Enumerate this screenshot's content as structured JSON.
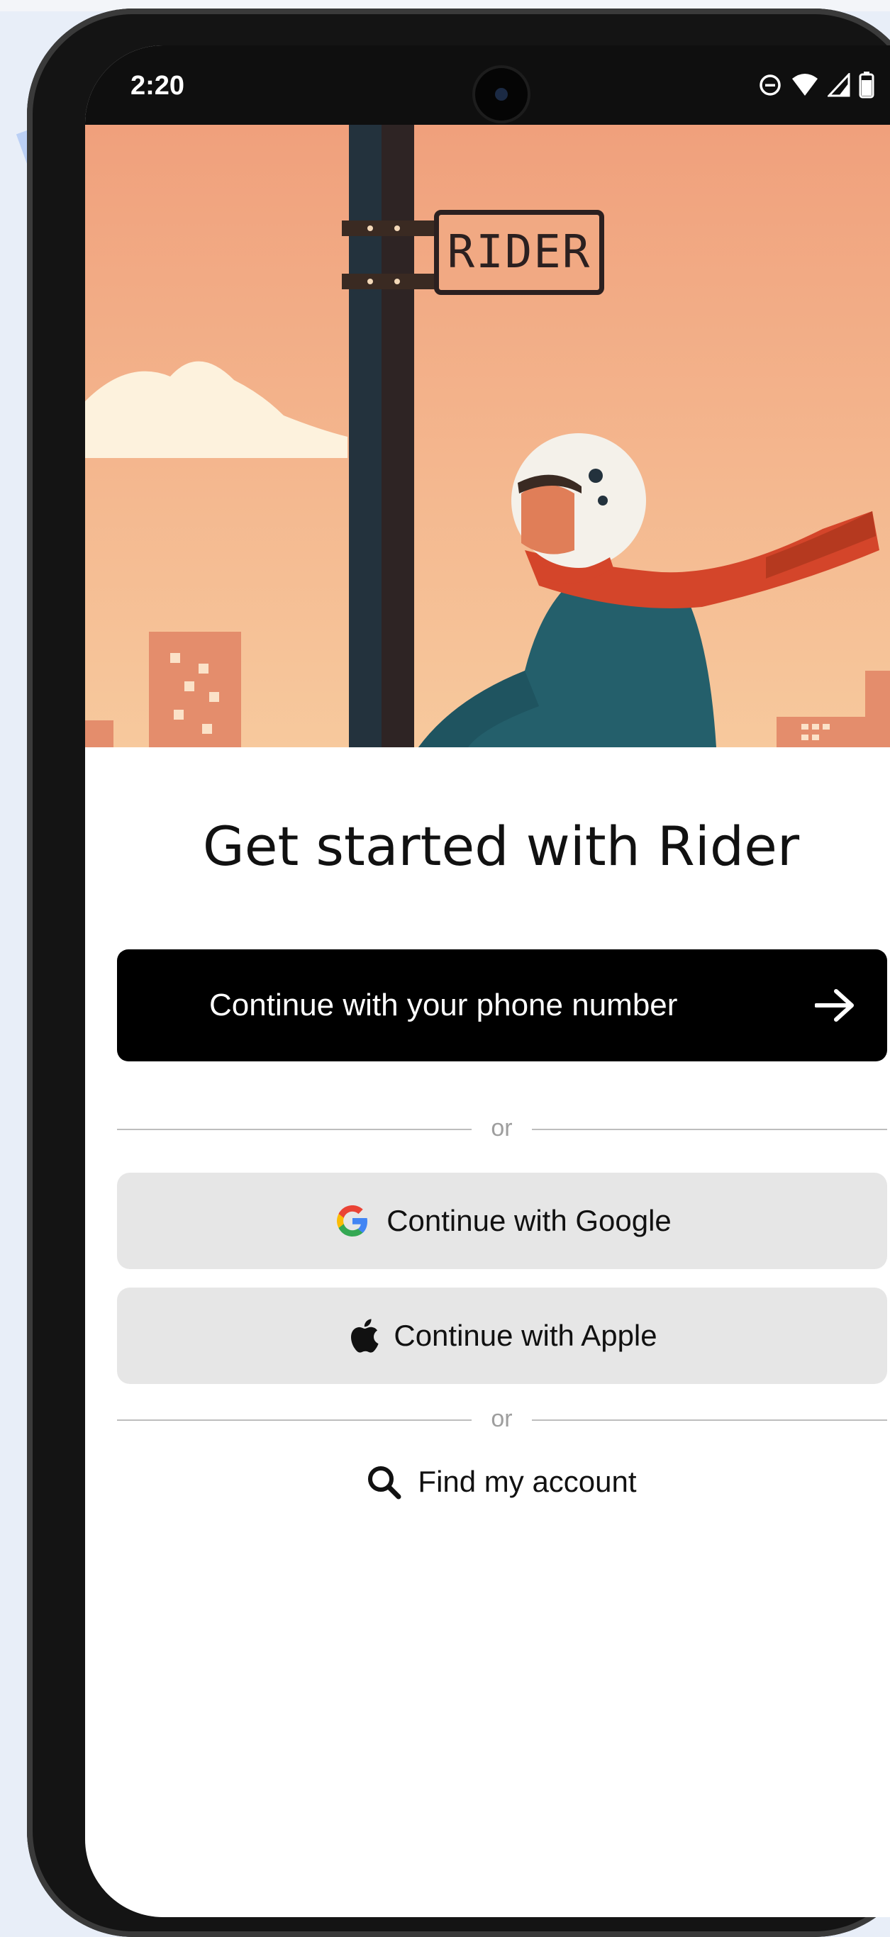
{
  "status_bar": {
    "time": "2:20",
    "icons": [
      "do-not-disturb-icon",
      "wifi-icon",
      "signal-icon",
      "battery-icon"
    ]
  },
  "hero": {
    "sign_text": "RIDER",
    "colors": {
      "sky_top": "#f0a07c",
      "sky_bottom": "#f7c79a",
      "pole": "#23323d",
      "helmet": "#f4f1ea",
      "scarf": "#d4452a",
      "jacket": "#245f6b"
    }
  },
  "main": {
    "title": "Get started with Rider",
    "primary_button": {
      "label": "Continue with your phone number",
      "icon": "arrow-right-icon"
    },
    "divider_text_1": "or",
    "google_button": {
      "label": "Continue with Google",
      "icon": "google-icon"
    },
    "apple_button": {
      "label": "Continue with Apple",
      "icon": "apple-icon"
    },
    "divider_text_2": "or",
    "find_account": {
      "label": "Find my account",
      "icon": "search-icon"
    }
  }
}
